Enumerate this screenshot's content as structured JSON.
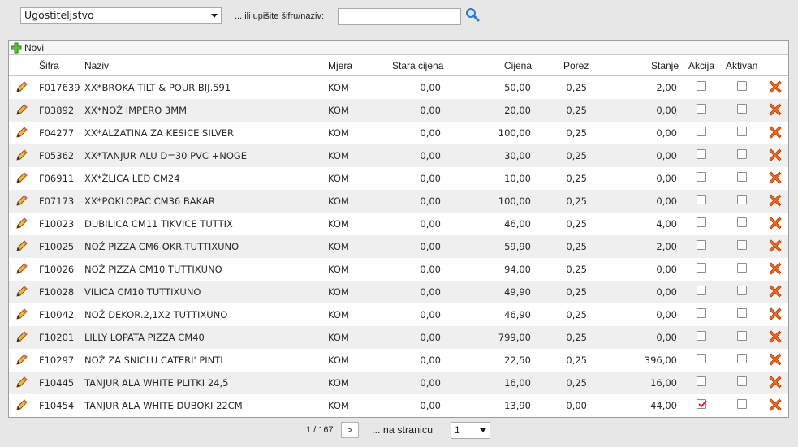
{
  "filter": {
    "category_value": "Ugostiteljstvo",
    "search_label": "... ili upišite šifru/naziv:",
    "search_value": "",
    "search_icon": "search-icon"
  },
  "toolbar": {
    "new_label": "Novi",
    "new_icon": "add-plus-icon"
  },
  "columns": {
    "sifra": "Šifra",
    "naziv": "Naziv",
    "mjera": "Mjera",
    "stara_cijena": "Stara cijena",
    "cijena": "Cijena",
    "porez": "Porez",
    "stanje": "Stanje",
    "akcija": "Akcija",
    "aktivan": "Aktivan"
  },
  "rows": [
    {
      "sifra": "F017639",
      "naziv": "XX*BROKA TILT & POUR BIJ.591",
      "mjera": "KOM",
      "stara_cijena": "0,00",
      "cijena": "50,00",
      "porez": "0,25",
      "stanje": "2,00",
      "akcija": false,
      "aktivan": false
    },
    {
      "sifra": "F03892",
      "naziv": "XX*NOŽ IMPERO 3MM",
      "mjera": "KOM",
      "stara_cijena": "0,00",
      "cijena": "20,00",
      "porez": "0,25",
      "stanje": "0,00",
      "akcija": false,
      "aktivan": false
    },
    {
      "sifra": "F04277",
      "naziv": "XX*ALZATINA ZA KESICE SILVER",
      "mjera": "KOM",
      "stara_cijena": "0,00",
      "cijena": "100,00",
      "porez": "0,25",
      "stanje": "0,00",
      "akcija": false,
      "aktivan": false
    },
    {
      "sifra": "F05362",
      "naziv": "XX*TANJUR ALU D=30 PVC +NOGE",
      "mjera": "KOM",
      "stara_cijena": "0,00",
      "cijena": "30,00",
      "porez": "0,25",
      "stanje": "0,00",
      "akcija": false,
      "aktivan": false
    },
    {
      "sifra": "F06911",
      "naziv": "XX*ŽLICA LED CM24",
      "mjera": "KOM",
      "stara_cijena": "0,00",
      "cijena": "10,00",
      "porez": "0,25",
      "stanje": "0,00",
      "akcija": false,
      "aktivan": false
    },
    {
      "sifra": "F07173",
      "naziv": "XX*POKLOPAC CM36 BAKAR",
      "mjera": "KOM",
      "stara_cijena": "0,00",
      "cijena": "100,00",
      "porez": "0,25",
      "stanje": "0,00",
      "akcija": false,
      "aktivan": false
    },
    {
      "sifra": "F10023",
      "naziv": "DUBILICA CM11 TIKVICE TUTTIX",
      "mjera": "KOM",
      "stara_cijena": "0,00",
      "cijena": "46,00",
      "porez": "0,25",
      "stanje": "4,00",
      "akcija": false,
      "aktivan": false
    },
    {
      "sifra": "F10025",
      "naziv": "NOŽ PIZZA CM6 OKR.TUTTIXUNO",
      "mjera": "KOM",
      "stara_cijena": "0,00",
      "cijena": "59,90",
      "porez": "0,25",
      "stanje": "2,00",
      "akcija": false,
      "aktivan": false
    },
    {
      "sifra": "F10026",
      "naziv": "NOŽ PIZZA CM10 TUTTIXUNO",
      "mjera": "KOM",
      "stara_cijena": "0,00",
      "cijena": "94,00",
      "porez": "0,25",
      "stanje": "0,00",
      "akcija": false,
      "aktivan": false
    },
    {
      "sifra": "F10028",
      "naziv": "VILICA CM10 TUTTIXUNO",
      "mjera": "KOM",
      "stara_cijena": "0,00",
      "cijena": "49,90",
      "porez": "0,25",
      "stanje": "0,00",
      "akcija": false,
      "aktivan": false
    },
    {
      "sifra": "F10042",
      "naziv": "NOŽ DEKOR.2,1X2 TUTTIXUNO",
      "mjera": "KOM",
      "stara_cijena": "0,00",
      "cijena": "46,90",
      "porez": "0,25",
      "stanje": "0,00",
      "akcija": false,
      "aktivan": false
    },
    {
      "sifra": "F10201",
      "naziv": "LILLY LOPATA PIZZA CM40",
      "mjera": "KOM",
      "stara_cijena": "0,00",
      "cijena": "799,00",
      "porez": "0,25",
      "stanje": "0,00",
      "akcija": false,
      "aktivan": false
    },
    {
      "sifra": "F10297",
      "naziv": "NOŽ ZA ŠNICLU CATERI' PINTI",
      "mjera": "KOM",
      "stara_cijena": "0,00",
      "cijena": "22,50",
      "porez": "0,25",
      "stanje": "396,00",
      "akcija": false,
      "aktivan": false
    },
    {
      "sifra": "F10445",
      "naziv": "TANJUR ALA WHITE PLITKI 24,5",
      "mjera": "KOM",
      "stara_cijena": "0,00",
      "cijena": "16,00",
      "porez": "0,25",
      "stanje": "16,00",
      "akcija": false,
      "aktivan": false
    },
    {
      "sifra": "F10454",
      "naziv": "TANJUR ALA WHITE DUBOKI 22CM",
      "mjera": "KOM",
      "stara_cijena": "0,00",
      "cijena": "13,90",
      "porez": "0,00",
      "stanje": "44,00",
      "akcija": true,
      "aktivan": false
    }
  ],
  "row_icons": {
    "edit": "pencil-edit-icon",
    "delete": "red-x-delete-icon"
  },
  "pager": {
    "page_info": "1 / 167",
    "next_label": ">",
    "per_page_label": "... na stranicu",
    "per_page_value": "1"
  },
  "colors": {
    "delete": "#e04a10",
    "checked": "#d8262e",
    "search": "#2d7bc8",
    "add": "#46a32c"
  }
}
